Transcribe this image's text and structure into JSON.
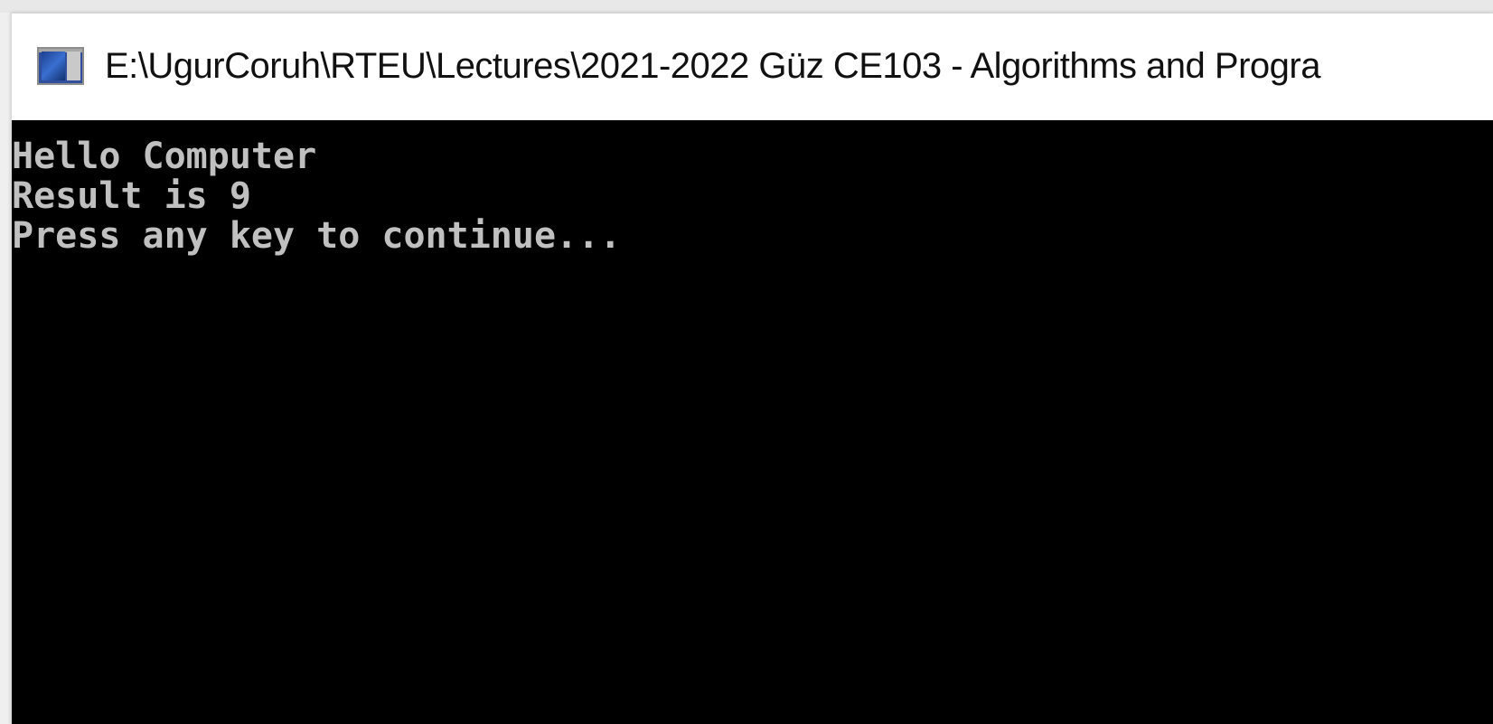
{
  "window": {
    "title": "E:\\UgurCoruh\\RTEU\\Lectures\\2021-2022 Güz CE103 - Algorithms and Progra",
    "icon": "console-window-icon"
  },
  "console": {
    "lines": [
      "Hello Computer",
      "Result is 9",
      "Press any key to continue..."
    ],
    "background_color": "#000000",
    "text_color": "#c0c0c0"
  }
}
